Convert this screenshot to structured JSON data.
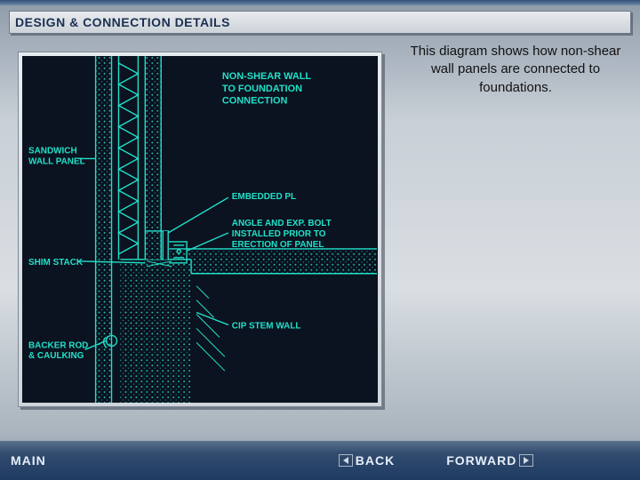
{
  "header": {
    "title": "DESIGN & CONNECTION DETAILS"
  },
  "caption": {
    "text": "This diagram shows how non-shear wall panels are connected to foundations."
  },
  "diagram": {
    "title_l1": "NON-SHEAR WALL",
    "title_l2": "TO FOUNDATION",
    "title_l3": "CONNECTION",
    "labels": {
      "sandwich_panel": "SANDWICH\nWALL PANEL",
      "embedded_plate": "EMBEDDED PL",
      "angle_bolt_l1": "ANGLE AND EXP. BOLT",
      "angle_bolt_l2": "INSTALLED PRIOR TO",
      "angle_bolt_l3": "ERECTION OF PANEL",
      "shim_stack": "SHIM STACK",
      "cip_stem": "CIP STEM WALL",
      "backer_l1": "BACKER ROD",
      "backer_l2": "& CAULKING"
    }
  },
  "nav": {
    "main": "MAIN",
    "back": "BACK",
    "forward": "FORWARD"
  }
}
